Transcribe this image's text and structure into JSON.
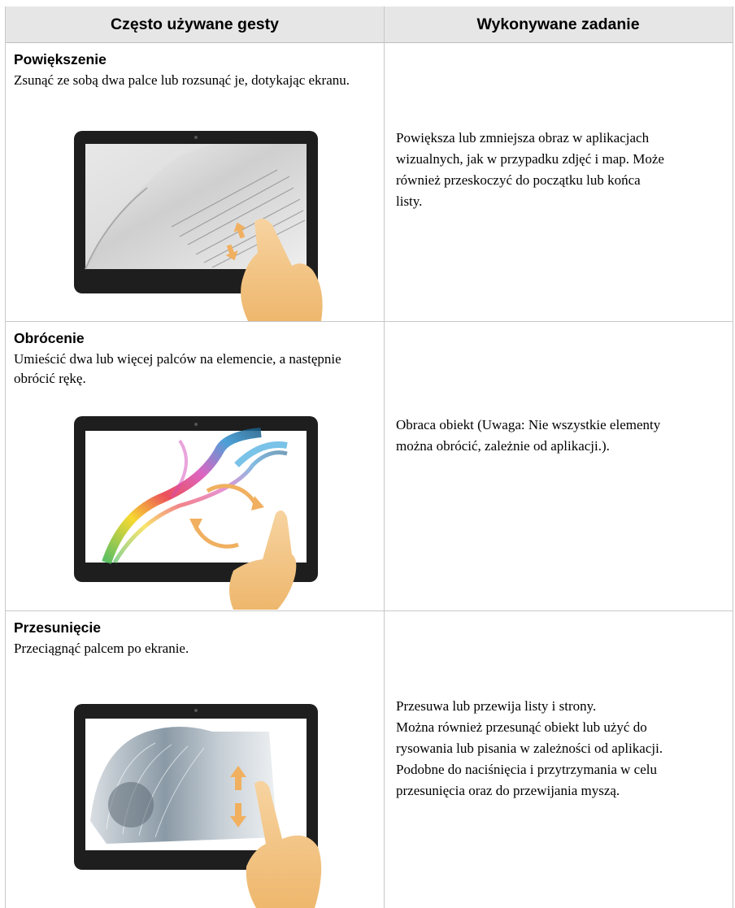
{
  "header": {
    "col1": "Często używane gesty",
    "col2": "Wykonywane zadanie"
  },
  "rows": [
    {
      "title": "Powiększenie",
      "description": "Zsunąć ze sobą dwa palce lub rozsunąć je, dotykając ekranu.",
      "task_lines": [
        "Powiększa lub zmniejsza obraz w aplikacjach",
        "wizualnych, jak w przypadku zdjęć i map. Może",
        "również przeskoczyć do początku lub końca",
        "listy."
      ],
      "image": "tablet-pinch-zoom-book"
    },
    {
      "title": "Obrócenie",
      "description": "Umieścić dwa lub więcej palców na elemencie, a następnie obrócić rękę.",
      "task_lines": [
        "Obraca obiekt (Uwaga: Nie wszystkie elementy",
        "można obrócić, zależnie od aplikacji.)."
      ],
      "image": "tablet-rotate-smoke"
    },
    {
      "title": "Przesunięcie",
      "description": "Przeciągnąć palcem po ekranie.",
      "task_lines": [
        "Przesuwa lub przewija listy i strony.",
        "Można również przesunąć obiekt lub użyć do",
        "rysowania lub pisania w zależności od aplikacji.",
        "Podobne do naciśnięcia i przytrzymania w celu",
        "przesunięcia oraz do przewijania myszą."
      ],
      "image": "tablet-swipe-magazine"
    }
  ],
  "colors": {
    "header_bg": "#e6e6e6",
    "border": "#c8c8c8",
    "tablet_frame": "#1e1e1e",
    "hand": "#f2c48a",
    "arrow": "#f0b060"
  }
}
